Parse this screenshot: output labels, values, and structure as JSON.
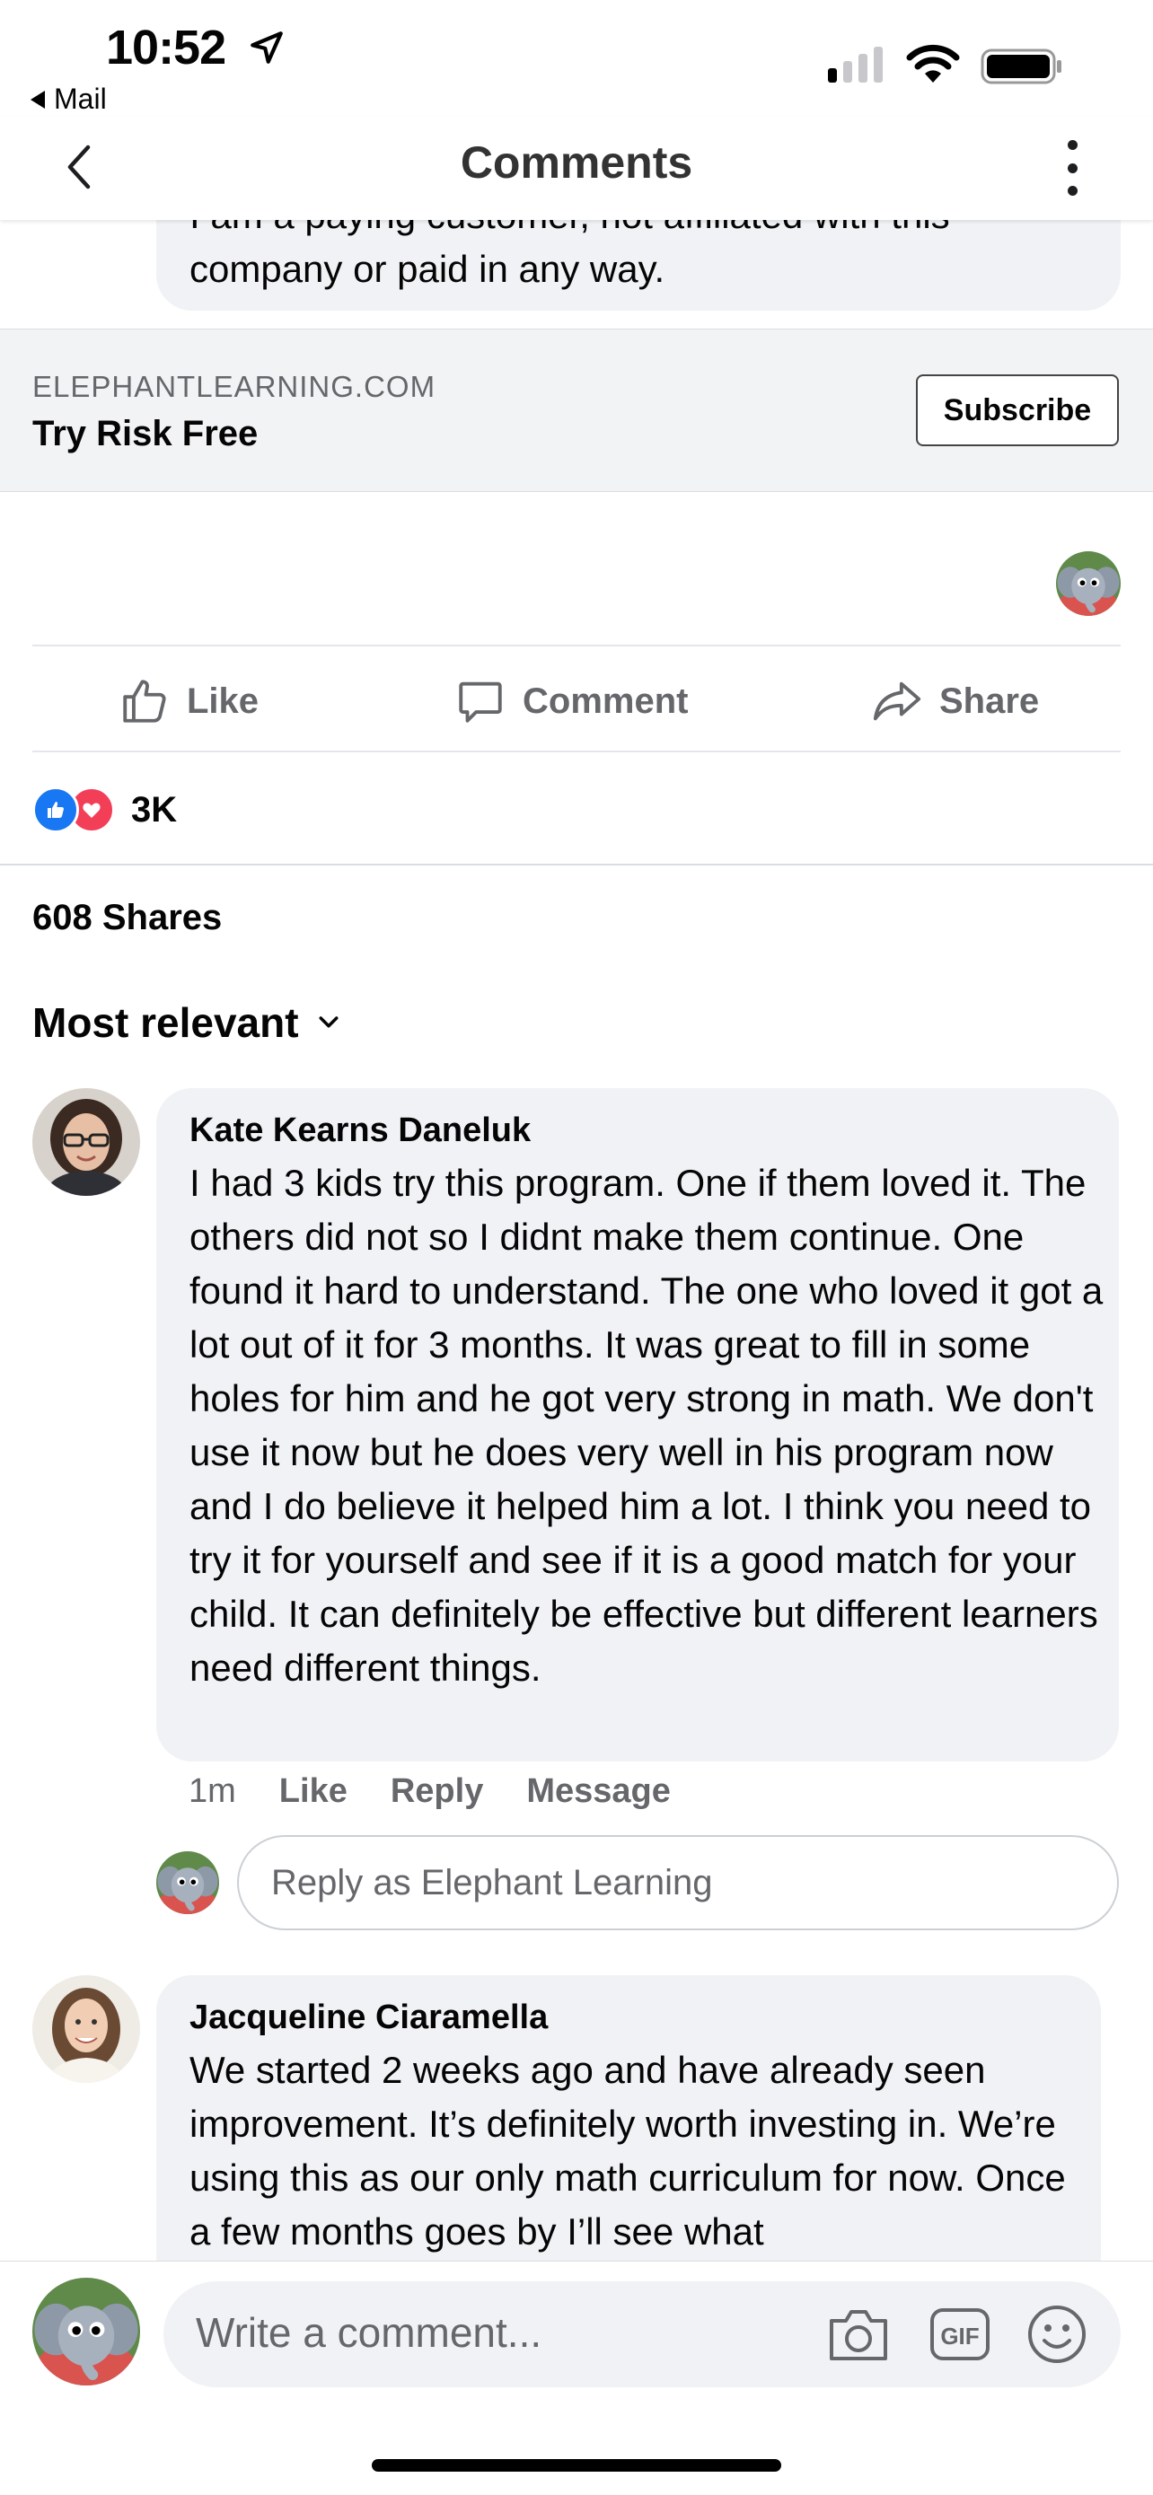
{
  "status_bar": {
    "time": "10:52",
    "back_app": "Mail"
  },
  "header": {
    "title": "Comments"
  },
  "cut_comment": {
    "text_line1": "I am a paying customer, not affiliated with this",
    "text_line2": "company or paid in any way."
  },
  "link_card": {
    "domain": "ELEPHANTLEARNING.COM",
    "title": "Try Risk Free",
    "button": "Subscribe"
  },
  "actions": {
    "like": "Like",
    "comment": "Comment",
    "share": "Share"
  },
  "reactions": {
    "count": "3K"
  },
  "shares": "608 Shares",
  "sort": {
    "label": "Most relevant"
  },
  "comments": [
    {
      "author": "Kate Kearns Daneluk",
      "text": "I had 3 kids try this program. One if them loved it.  The others did not so I didnt make them continue.  One found it hard to understand.  The one who loved it got a lot out of it for 3 months.  It was great to fill in some holes for him and he got very strong in math.  We don't use it now but he does very well in his program now and I do believe it helped him a lot.  I think you need to try it for yourself and see if it is a good match for your child.  It can definitely be effective but different learners need different things.",
      "time": "1m",
      "like": "Like",
      "reply": "Reply",
      "message": "Message"
    },
    {
      "author": "Jacqueline Ciaramella",
      "text": "We started 2 weeks ago and have already seen improvement. It’s definitely worth investing in. We’re using this as our only math curriculum for now. Once a few months goes by I’ll see what"
    }
  ],
  "reply_box": {
    "placeholder": "Reply as Elephant Learning"
  },
  "composer": {
    "placeholder": "Write a comment..."
  },
  "colors": {
    "like_blue": "#1877f2",
    "love_red": "#f33e58",
    "bubble_gray": "#f0f2f5",
    "secondary_text": "#65676b"
  }
}
